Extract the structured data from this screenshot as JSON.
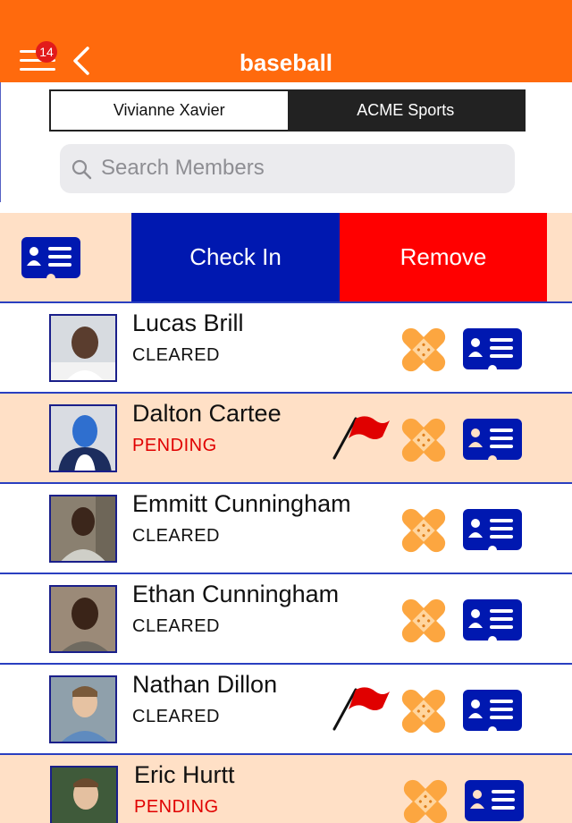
{
  "header": {
    "title": "baseball",
    "badge_count": "14",
    "background_color": "#FF6A0D"
  },
  "segments": [
    {
      "label": "Vivianne Xavier",
      "active": true
    },
    {
      "label": "ACME Sports",
      "active": false
    }
  ],
  "search": {
    "placeholder": "Search Members"
  },
  "swipe_actions": {
    "check_in_label": "Check In",
    "remove_label": "Remove",
    "check_in_color": "#0018B0",
    "remove_color": "#FF0000"
  },
  "members": [
    {
      "name": "Lucas Brill",
      "status": "CLEARED",
      "status_color": "#111111",
      "flagged": false,
      "avatar": "photo"
    },
    {
      "name": "Dalton Cartee",
      "status": "PENDING",
      "status_color": "#E00000",
      "flagged": true,
      "avatar": "placeholder"
    },
    {
      "name": "Emmitt Cunningham",
      "status": "CLEARED",
      "status_color": "#111111",
      "flagged": false,
      "avatar": "photo"
    },
    {
      "name": "Ethan Cunningham",
      "status": "CLEARED",
      "status_color": "#111111",
      "flagged": false,
      "avatar": "photo"
    },
    {
      "name": "Nathan Dillon",
      "status": "CLEARED",
      "status_color": "#111111",
      "flagged": true,
      "avatar": "photo"
    },
    {
      "name": "Eric Hurtt",
      "status": "PENDING",
      "status_color": "#E00000",
      "flagged": false,
      "avatar": "photo"
    }
  ],
  "icons": {
    "menu": "hamburger-icon",
    "back": "chevron-left-icon",
    "search": "magnifier-icon",
    "injury": "bandaid-icon",
    "id_card": "id-card-icon",
    "flag": "red-flag-icon"
  }
}
